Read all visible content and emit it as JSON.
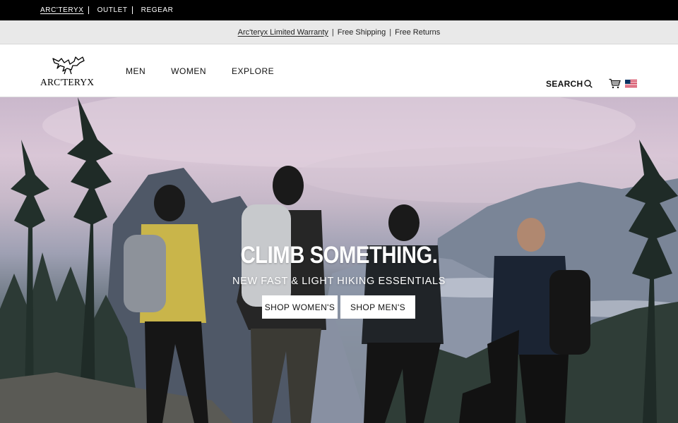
{
  "utility_bar": {
    "links": [
      "ARC'TERYX",
      "OUTLET",
      "REGEAR"
    ]
  },
  "promo_bar": {
    "warranty_link": "Arc'teryx Limited Warranty",
    "shipping": "Free Shipping",
    "returns": "Free Returns",
    "separator": "|"
  },
  "header": {
    "logo_text": "ARC'TERYX",
    "nav": [
      "MEN",
      "WOMEN",
      "EXPLORE"
    ],
    "search_label": "SEARCH"
  },
  "hero": {
    "title": "CLIMB SOMETHING.",
    "subtitle": "NEW FAST & LIGHT HIKING ESSENTIALS",
    "buttons": [
      "SHOP WOMEN'S",
      "SHOP MEN'S"
    ]
  },
  "icons": {
    "search": "search-icon",
    "cart": "cart-icon",
    "flag": "us-flag-icon",
    "logo": "archaeopteryx-logo"
  },
  "colors": {
    "utility_bg": "#000000",
    "promo_bg": "#e9e9e9",
    "hero_sky": "#d9c6d6",
    "button_bg": "#ffffff"
  }
}
